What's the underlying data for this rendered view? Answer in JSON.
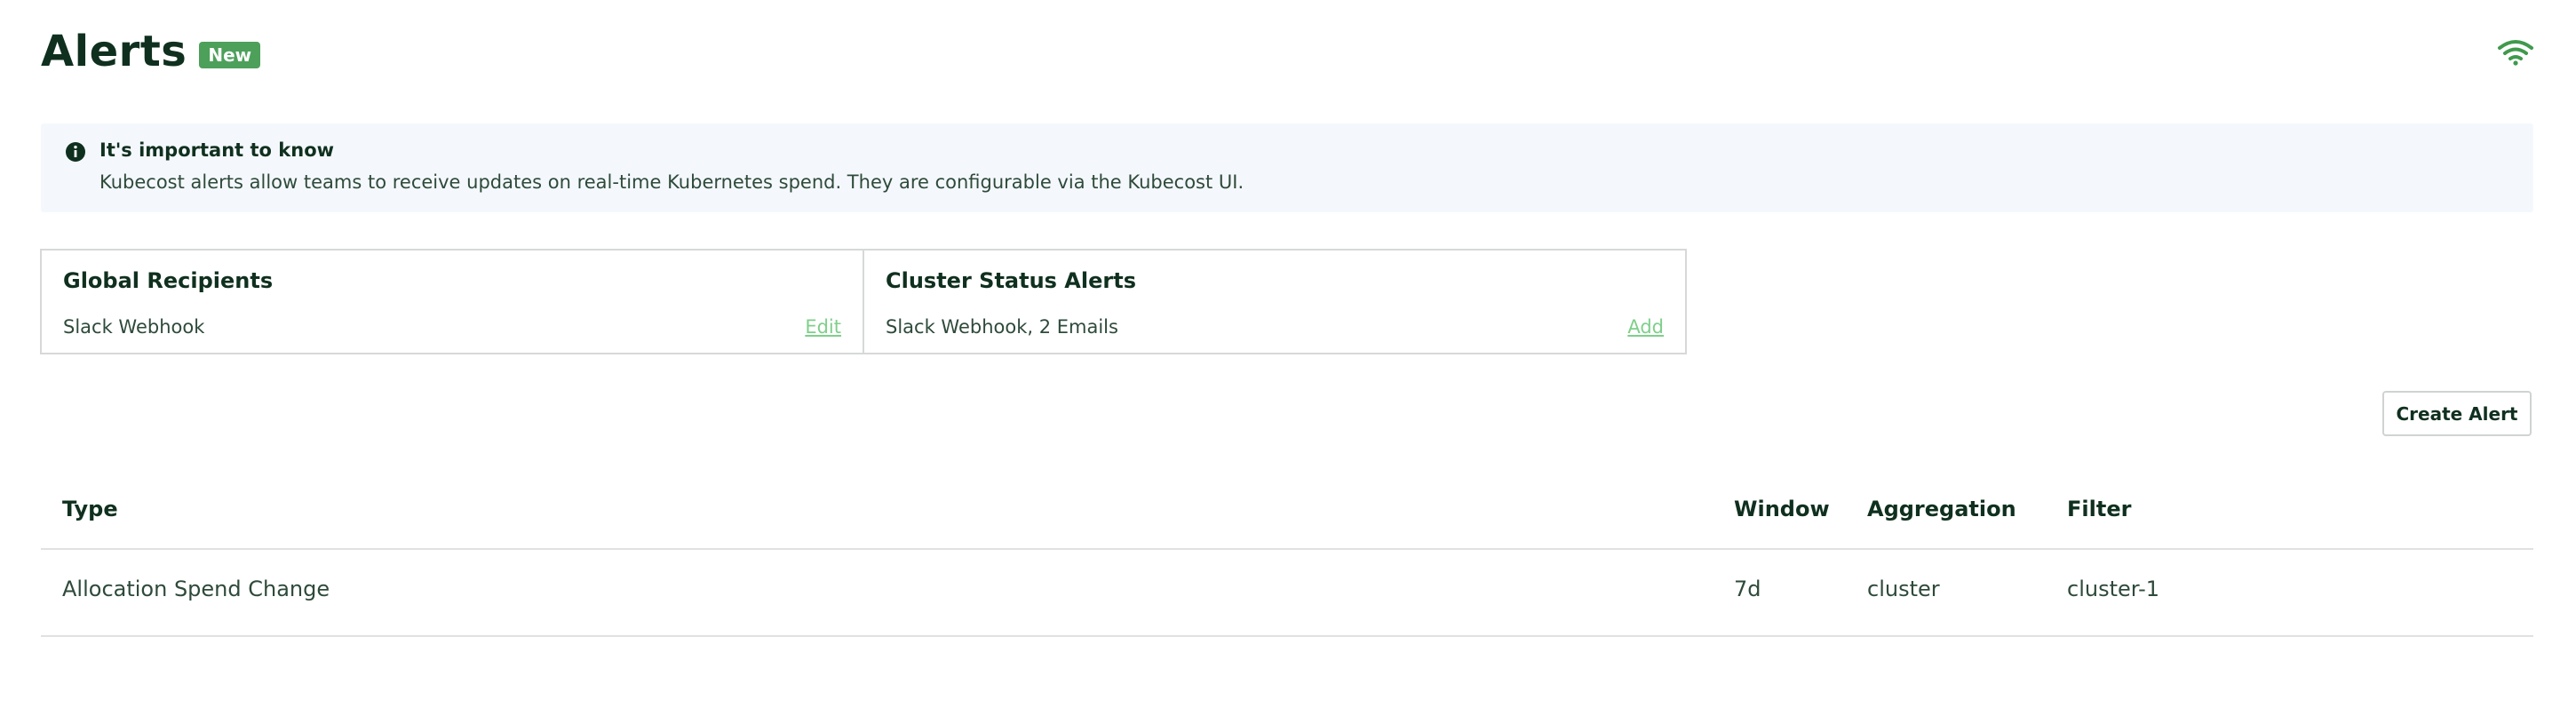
{
  "header": {
    "title": "Alerts",
    "badge": "New"
  },
  "info": {
    "icon": "info-icon",
    "title": "It's important to know",
    "text": "Kubecost alerts allow teams to receive updates on real-time Kubernetes spend. They are configurable via the Kubecost UI."
  },
  "cards": {
    "global": {
      "title": "Global Recipients",
      "value": "Slack Webhook",
      "action": "Edit"
    },
    "cluster": {
      "title": "Cluster Status Alerts",
      "value": "Slack Webhook, 2 Emails",
      "action": "Add"
    }
  },
  "create_button": "Create Alert",
  "table": {
    "headers": {
      "type": "Type",
      "window": "Window",
      "aggregation": "Aggregation",
      "filter": "Filter"
    },
    "rows": [
      {
        "type": "Allocation Spend Change",
        "window": "7d",
        "aggregation": "cluster",
        "filter": "cluster-1"
      }
    ]
  },
  "colors": {
    "accent": "#4da05a",
    "link": "#7fcf8a",
    "text_dark": "#10301f",
    "banner_bg": "#f4f8fc"
  }
}
